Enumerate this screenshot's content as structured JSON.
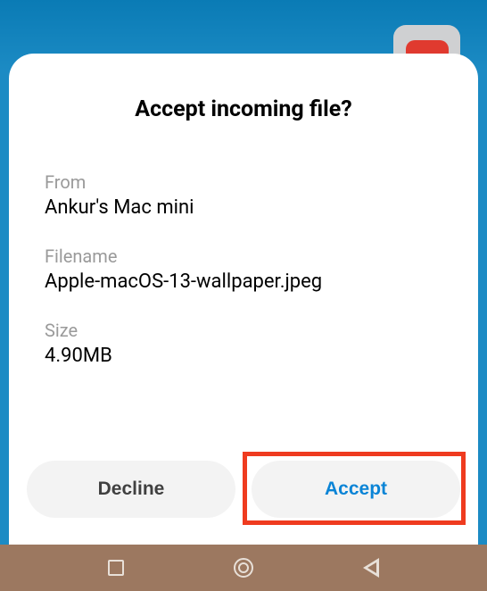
{
  "dialog": {
    "title": "Accept incoming file?",
    "from_label": "From",
    "from_value": "Ankur's Mac mini",
    "filename_label": "Filename",
    "filename_value": "Apple-macOS-13-wallpaper.jpeg",
    "size_label": "Size",
    "size_value": "4.90MB",
    "decline_label": "Decline",
    "accept_label": "Accept"
  }
}
